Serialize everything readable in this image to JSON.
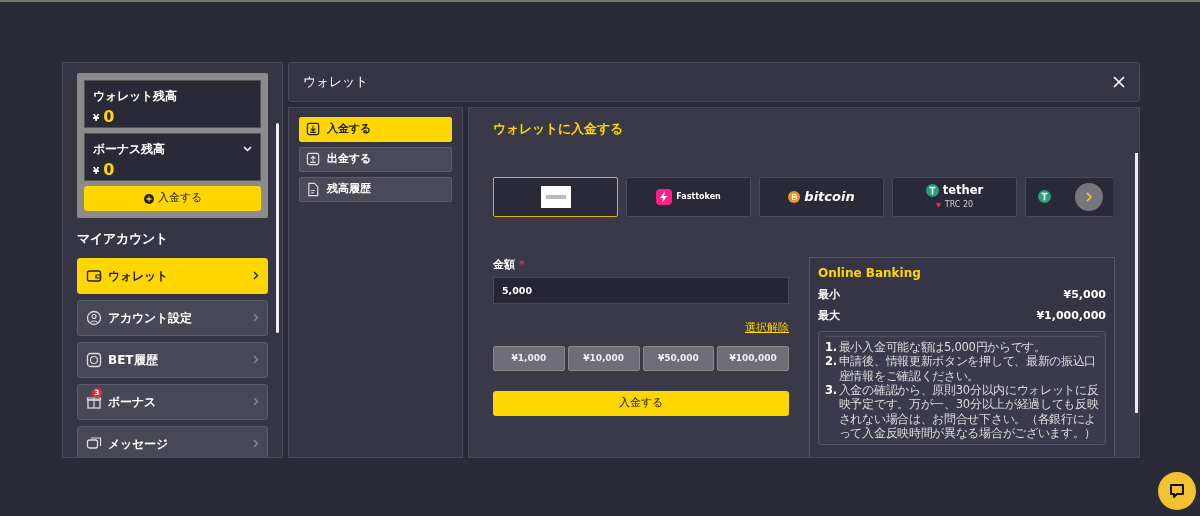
{
  "balances": [
    {
      "label": "ウォレット残高",
      "currency": "¥",
      "amount": "0",
      "expandable": false
    },
    {
      "label": "ボーナス残高",
      "currency": "¥",
      "amount": "0",
      "expandable": true
    }
  ],
  "deposit_button": "入金する",
  "account": {
    "title": "マイアカウント",
    "items": [
      {
        "label": "ウォレット",
        "kind": "wallet",
        "selected": true
      },
      {
        "label": "アカウント設定",
        "kind": "user",
        "selected": false
      },
      {
        "label": "BET履歴",
        "kind": "history",
        "selected": false
      },
      {
        "label": "ボーナス",
        "kind": "gift",
        "badge": "3",
        "selected": false
      },
      {
        "label": "メッセージ",
        "kind": "chat",
        "selected": false
      }
    ]
  },
  "window": {
    "title": "ウォレット"
  },
  "submenu": [
    {
      "label": "入金する",
      "kind": "download",
      "selected": true
    },
    {
      "label": "出金する",
      "kind": "upload",
      "selected": false
    },
    {
      "label": "残高履歴",
      "kind": "document",
      "selected": false
    }
  ],
  "deposit": {
    "title": "ウォレットに入金する",
    "methods": [
      {
        "kind": "bank",
        "selected": true
      },
      {
        "kind": "fasttoken",
        "name": "Fasttoken",
        "selected": false
      },
      {
        "kind": "bitcoin",
        "name": "bitcoin",
        "selected": false
      },
      {
        "kind": "tether",
        "name": "tether",
        "network": "TRC 20",
        "selected": false
      },
      {
        "kind": "tether",
        "selected": false
      }
    ],
    "amount_label": "金額",
    "required_mark": "*",
    "amount_value": "5,000",
    "clear_link": "選択解除",
    "presets": [
      "¥1,000",
      "¥10,000",
      "¥50,000",
      "¥100,000"
    ],
    "submit": "入金する"
  },
  "info": {
    "title": "Online Banking",
    "limits": [
      {
        "label": "最小",
        "value": "¥5,000"
      },
      {
        "label": "最大",
        "value": "¥1,000,000"
      }
    ],
    "notes": [
      {
        "number": "1.",
        "text": "最小入金可能な額は5,000円からです。"
      },
      {
        "number": "2.",
        "text": "申請後、情報更新ボタンを押して、最新の振込口座情報をご確認ください。"
      },
      {
        "number": "3.",
        "text": "入金の確認から、原則30分以内にウォレットに反映予定です。万が一、30分以上が経過しても反映されない場合は、お問合せ下さい。（各銀行によって入金反映時間が異なる場合がございます。）"
      }
    ]
  }
}
